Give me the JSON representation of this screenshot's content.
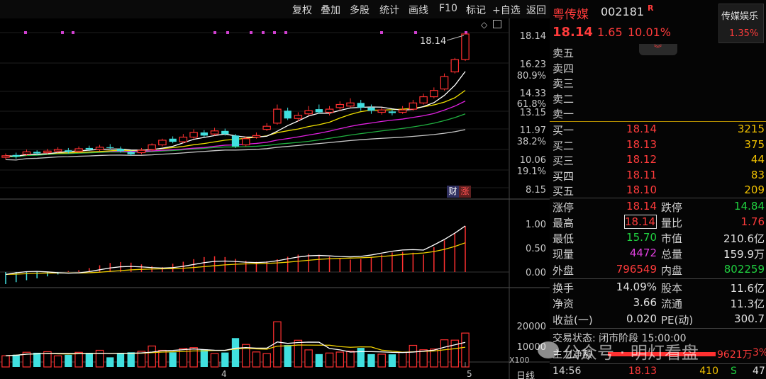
{
  "toolbar": {
    "buttons": [
      "复权",
      "叠加",
      "多股",
      "统计",
      "画线",
      "F10",
      "标记",
      "+自选",
      "返回"
    ]
  },
  "stock": {
    "name": "粤传媒",
    "code": "002181",
    "badge": "R",
    "price": "18.14",
    "change": "1.65",
    "change_pct": "10.01%",
    "sector": "传媒娱乐",
    "sector_pct": "1.35%"
  },
  "order_book": {
    "asks": [
      {
        "label": "卖五",
        "price": "",
        "vol": ""
      },
      {
        "label": "卖四",
        "price": "",
        "vol": ""
      },
      {
        "label": "卖三",
        "price": "",
        "vol": ""
      },
      {
        "label": "卖二",
        "price": "",
        "vol": ""
      },
      {
        "label": "卖一",
        "price": "",
        "vol": ""
      }
    ],
    "bids": [
      {
        "label": "买一",
        "price": "18.14",
        "vol": "3215"
      },
      {
        "label": "买二",
        "price": "18.13",
        "vol": "375"
      },
      {
        "label": "买三",
        "price": "18.12",
        "vol": "44"
      },
      {
        "label": "买四",
        "price": "18.11",
        "vol": "83"
      },
      {
        "label": "买五",
        "price": "18.10",
        "vol": "209"
      }
    ]
  },
  "quote": {
    "limit_up_label": "涨停",
    "limit_up": "18.14",
    "limit_down_label": "跌停",
    "limit_down": "14.84",
    "high_label": "最高",
    "high": "18.14",
    "vol_ratio_label": "量比",
    "vol_ratio": "1.76",
    "low_label": "最低",
    "low": "15.70",
    "mkt_cap_label": "市值",
    "mkt_cap": "210.6亿",
    "cur_vol_label": "现量",
    "cur_vol": "4472",
    "total_vol_label": "总量",
    "total_vol": "159.9万",
    "outer_label": "外盘",
    "outer": "796549",
    "inner_label": "内盘",
    "inner": "802259",
    "turnover_label": "换手",
    "turnover": "14.09%",
    "shares_label": "股本",
    "shares": "11.6亿",
    "nav_label": "净资",
    "nav": "3.66",
    "float_label": "流通",
    "float": "11.3亿",
    "eps_label": "收益(一)",
    "eps": "0.020",
    "pe_label": "PE(动)",
    "pe": "300.7",
    "trade_status": "交易状态: 闭市阶段 15:00:00",
    "main_flow_label": "主力净额",
    "main_flow_value": "9621万",
    "main_flow_pct": "3%",
    "tick_time": "14:56",
    "tick_price": "18.13",
    "tick_vol": "410",
    "tick_side": "S",
    "tick_count": "47"
  },
  "watermark": "公众号 · 明灯看盘",
  "chart_data": {
    "type": "candlestick",
    "price_axis_labels": [
      "18.14",
      "16.23",
      "80.9%",
      "14.33",
      "61.8%",
      "13.15",
      "11.97",
      "38.2%",
      "10.06",
      "19.1%",
      "8.15"
    ],
    "last_price_annotation": "18.14",
    "badges": [
      "财",
      "涨"
    ],
    "macd_axis_labels": [
      "1.00",
      "0.50",
      "0.00"
    ],
    "volume_axis_labels": [
      "20000",
      "10000"
    ],
    "volume_unit": "X100",
    "x_labels": [
      "4",
      "5"
    ],
    "period_label": "日线",
    "candles": [
      {
        "o": 10.2,
        "c": 10.3,
        "h": 10.45,
        "l": 10.05
      },
      {
        "o": 10.35,
        "c": 10.25,
        "h": 10.5,
        "l": 10.1
      },
      {
        "o": 10.4,
        "c": 10.55,
        "h": 10.7,
        "l": 10.3
      },
      {
        "o": 10.55,
        "c": 10.45,
        "h": 10.65,
        "l": 10.35
      },
      {
        "o": 10.5,
        "c": 10.6,
        "h": 10.75,
        "l": 10.4
      },
      {
        "o": 10.6,
        "c": 10.7,
        "h": 10.85,
        "l": 10.5
      },
      {
        "o": 10.65,
        "c": 10.55,
        "h": 10.8,
        "l": 10.45
      },
      {
        "o": 10.6,
        "c": 10.75,
        "h": 10.9,
        "l": 10.5
      },
      {
        "o": 10.8,
        "c": 10.7,
        "h": 10.95,
        "l": 10.6
      },
      {
        "o": 10.7,
        "c": 10.85,
        "h": 11.0,
        "l": 10.6
      },
      {
        "o": 10.85,
        "c": 10.8,
        "h": 11.05,
        "l": 10.7
      },
      {
        "o": 10.75,
        "c": 10.6,
        "h": 10.9,
        "l": 10.5
      },
      {
        "o": 10.55,
        "c": 10.4,
        "h": 10.65,
        "l": 10.3
      },
      {
        "o": 10.5,
        "c": 10.65,
        "h": 10.8,
        "l": 10.4
      },
      {
        "o": 10.7,
        "c": 11.0,
        "h": 11.1,
        "l": 10.6
      },
      {
        "o": 11.0,
        "c": 11.3,
        "h": 11.4,
        "l": 10.9
      },
      {
        "o": 11.4,
        "c": 11.2,
        "h": 11.55,
        "l": 11.1
      },
      {
        "o": 11.2,
        "c": 11.5,
        "h": 11.7,
        "l": 11.1
      },
      {
        "o": 11.5,
        "c": 11.8,
        "h": 12.0,
        "l": 11.4
      },
      {
        "o": 11.8,
        "c": 11.6,
        "h": 11.95,
        "l": 11.5
      },
      {
        "o": 11.7,
        "c": 11.9,
        "h": 12.1,
        "l": 11.6
      },
      {
        "o": 11.9,
        "c": 11.7,
        "h": 12.05,
        "l": 11.6
      },
      {
        "o": 11.6,
        "c": 10.9,
        "h": 11.7,
        "l": 10.8
      },
      {
        "o": 11.0,
        "c": 11.4,
        "h": 11.55,
        "l": 10.9
      },
      {
        "o": 11.5,
        "c": 11.6,
        "h": 11.8,
        "l": 11.4
      },
      {
        "o": 12.0,
        "c": 12.2,
        "h": 12.4,
        "l": 11.9
      },
      {
        "o": 12.4,
        "c": 13.3,
        "h": 13.6,
        "l": 12.3
      },
      {
        "o": 13.2,
        "c": 12.7,
        "h": 13.4,
        "l": 12.6
      },
      {
        "o": 12.7,
        "c": 12.9,
        "h": 13.1,
        "l": 12.5
      },
      {
        "o": 13.0,
        "c": 13.2,
        "h": 13.5,
        "l": 12.9
      },
      {
        "o": 13.3,
        "c": 13.1,
        "h": 13.6,
        "l": 13.0
      },
      {
        "o": 13.1,
        "c": 13.3,
        "h": 13.5,
        "l": 12.9
      },
      {
        "o": 13.4,
        "c": 13.6,
        "h": 13.8,
        "l": 13.2
      },
      {
        "o": 13.5,
        "c": 13.7,
        "h": 14.0,
        "l": 13.4
      },
      {
        "o": 13.7,
        "c": 13.4,
        "h": 13.9,
        "l": 13.2
      },
      {
        "o": 13.4,
        "c": 13.2,
        "h": 13.6,
        "l": 13.0
      },
      {
        "o": 13.1,
        "c": 13.25,
        "h": 13.4,
        "l": 12.95
      },
      {
        "o": 13.15,
        "c": 13.05,
        "h": 13.3,
        "l": 12.9
      },
      {
        "o": 13.1,
        "c": 13.25,
        "h": 13.5,
        "l": 13.0
      },
      {
        "o": 13.3,
        "c": 13.7,
        "h": 13.9,
        "l": 13.2
      },
      {
        "o": 13.7,
        "c": 14.1,
        "h": 14.3,
        "l": 13.6
      },
      {
        "o": 14.1,
        "c": 14.5,
        "h": 14.7,
        "l": 14.0
      },
      {
        "o": 14.6,
        "c": 15.4,
        "h": 15.6,
        "l": 14.5
      },
      {
        "o": 15.7,
        "c": 16.49,
        "h": 16.6,
        "l": 15.6
      },
      {
        "o": 16.5,
        "c": 18.14,
        "h": 18.14,
        "l": 16.4
      }
    ]
  }
}
